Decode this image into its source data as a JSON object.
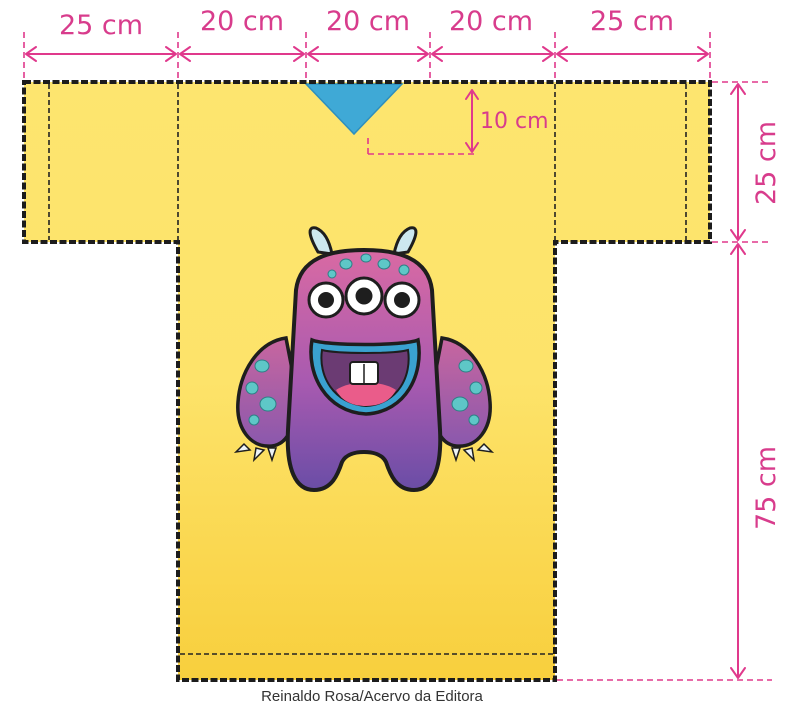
{
  "dimensions": {
    "top": [
      "25 cm",
      "20 cm",
      "20 cm",
      "20 cm",
      "25 cm"
    ],
    "neck_depth": "10 cm",
    "sleeve_height": "25 cm",
    "body_height": "75 cm"
  },
  "credit": "Reinaldo Rosa/Acervo da Editora",
  "colors": {
    "dimension": "#e0398c",
    "shirt_top": "#fde36e",
    "shirt_bottom": "#f9cf3c",
    "neck": "#3fa9d6",
    "monster_top": "#d9679e",
    "monster_bottom": "#6a4ea6",
    "spots": "#5ec7c7"
  }
}
